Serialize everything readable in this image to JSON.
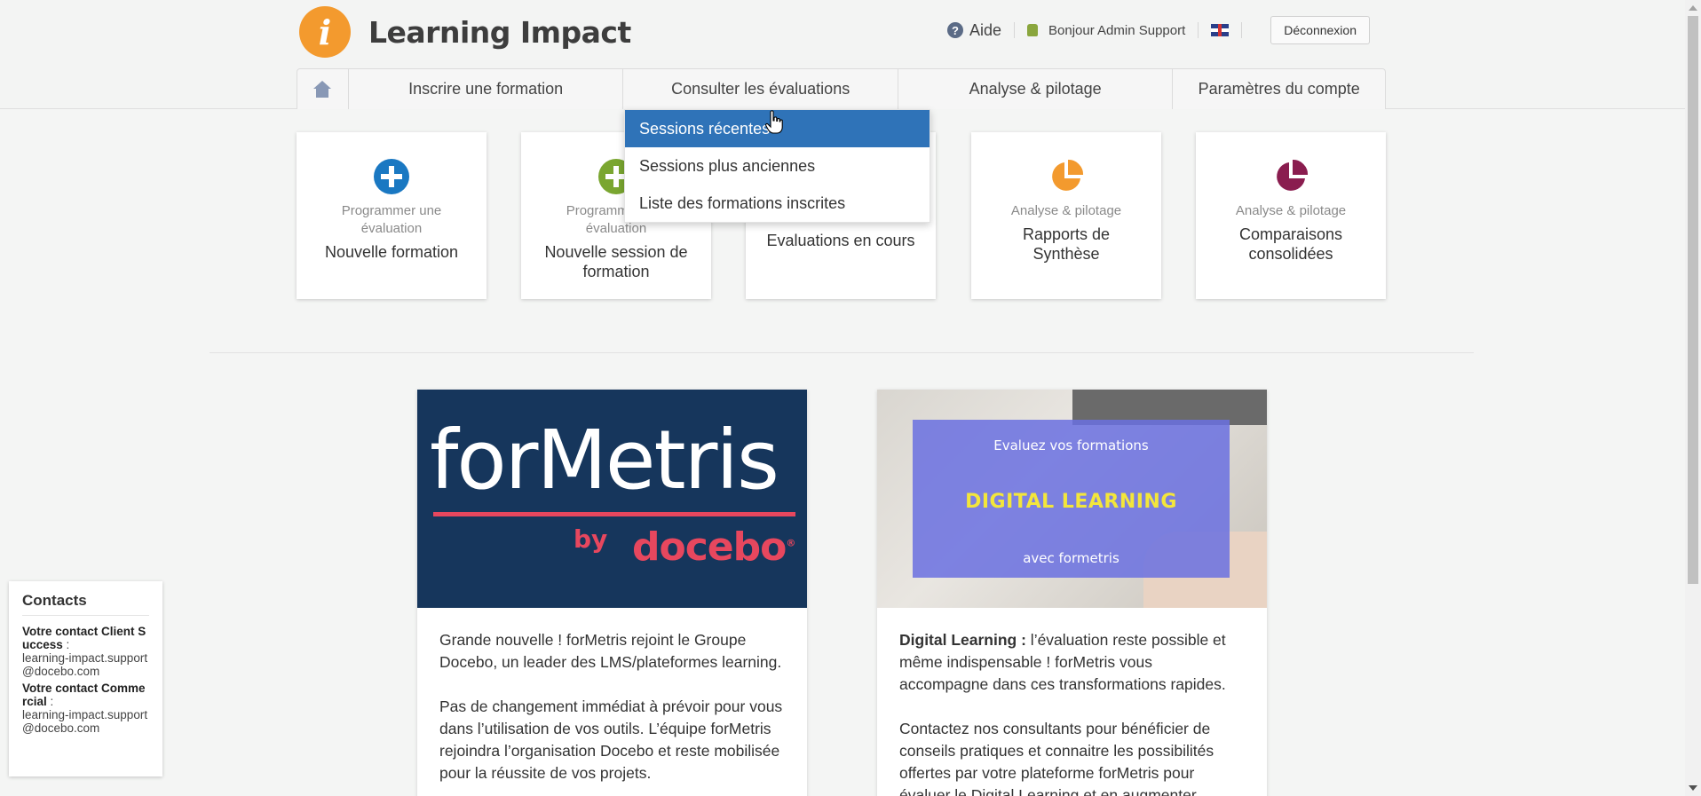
{
  "brand": {
    "logo_letter": "i",
    "name": "Learning Impact",
    "accent": "#f39a2e"
  },
  "topbar": {
    "help_label": "Aide",
    "greeting": "Bonjour Admin Support",
    "language_flag": "uk-flag-icon",
    "logout_label": "Déconnexion"
  },
  "nav": {
    "home_icon": "home-icon",
    "items": [
      {
        "label": "Inscrire une formation"
      },
      {
        "label": "Consulter les évaluations"
      },
      {
        "label": "Analyse & pilotage"
      },
      {
        "label": "Paramètres du compte"
      }
    ]
  },
  "dropdown": {
    "items": [
      {
        "label": "Sessions récentes",
        "active": true
      },
      {
        "label": "Sessions plus anciennes"
      },
      {
        "label": "Liste des formations inscrites"
      }
    ],
    "active_color": "#2f73b8"
  },
  "cards": [
    {
      "icon": "plus-circle-icon",
      "icon_color": "#1a78c2",
      "subtitle": "Programmer une évaluation",
      "title": "Nouvelle formation"
    },
    {
      "icon": "plus-circle-icon",
      "icon_color": "#7aa630",
      "subtitle": "Programmer une évaluation",
      "title": "Nouvelle session de formation"
    },
    {
      "icon": "",
      "icon_color": "",
      "subtitle": "",
      "title": "Evaluations en cours"
    },
    {
      "icon": "pie-chart-icon",
      "icon_color": "#f39a2e",
      "subtitle": "Analyse & pilotage",
      "title": "Rapports de Synthèse"
    },
    {
      "icon": "pie-chart-icon",
      "icon_color": "#8a1d4f",
      "subtitle": "Analyse & pilotage",
      "title": "Comparaisons consolidées"
    }
  ],
  "news": [
    {
      "image": {
        "brand_word_1": "for",
        "brand_word_2": "M",
        "brand_word_3": "etris",
        "by": "by",
        "docebo": "docebo",
        "registered": "®"
      },
      "paragraphs": [
        "Grande nouvelle ! forMetris rejoint le Groupe Docebo, un leader des LMS/plateformes learning.",
        "Pas de changement immédiat à prévoir pour vous dans l’utilisation de vos outils. L’équipe forMetris rejoindra l’organisation Docebo et reste mobilisée pour la réussite de vos projets."
      ]
    },
    {
      "image": {
        "line1": "Evaluez vos formations",
        "line2": "DIGITAL LEARNING",
        "line3": "avec formetris"
      },
      "lead_bold": "Digital Learning :",
      "lead_rest": " l’évaluation reste possible et même indispensable ! forMetris vous accompagne dans ces transformations rapides.",
      "paragraph2": "Contactez nos consultants pour bénéficier de conseils pratiques et connaitre les possibilités offertes par votre plateforme forMetris pour évaluer le Digital Learning et en augmenter"
    }
  ],
  "contacts": {
    "title": "Contacts",
    "client_success_label": "Votre contact Client Success",
    "client_success_email": "learning-impact.support@docebo.com",
    "commercial_label": "Votre contact Commercial",
    "commercial_email": "learning-impact.support@docebo.com",
    "separator": " :"
  }
}
